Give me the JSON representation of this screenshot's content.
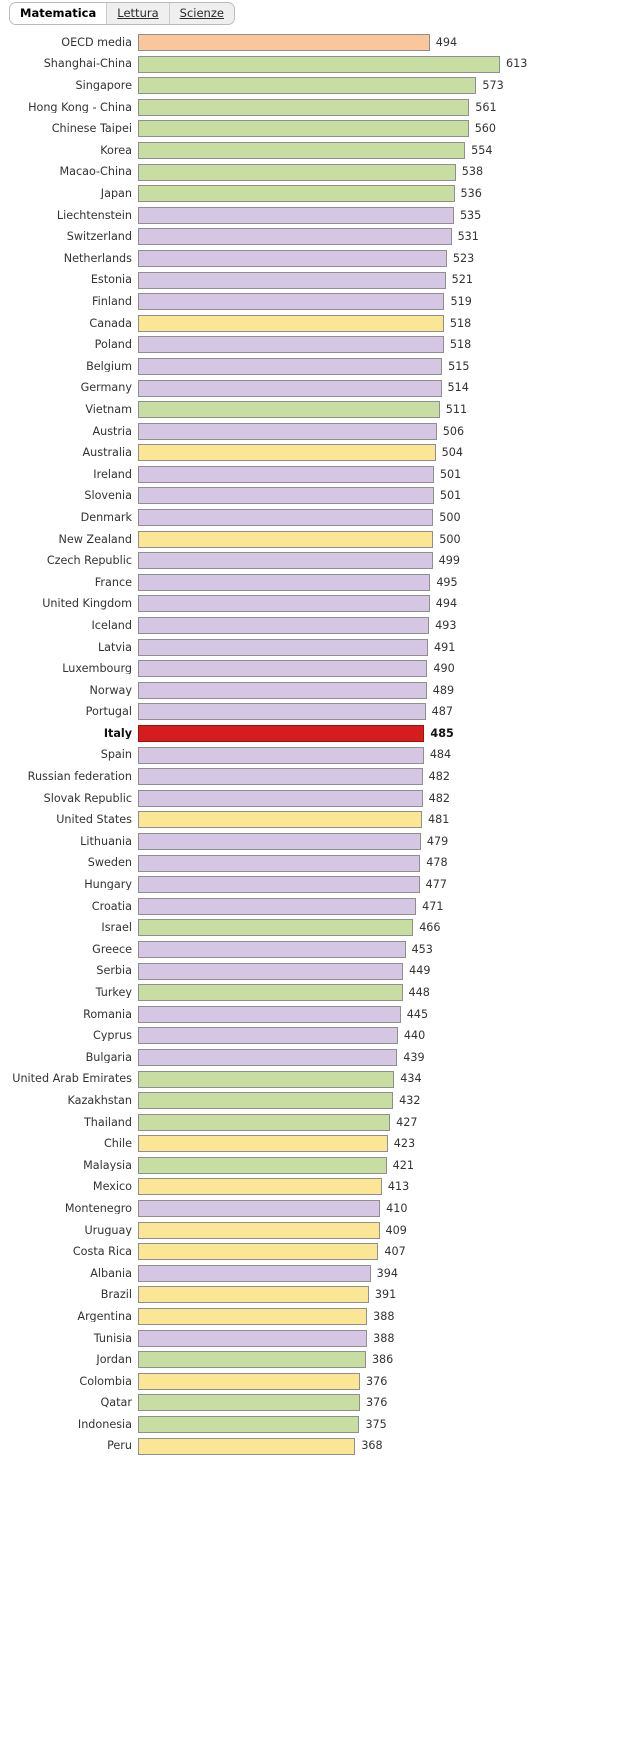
{
  "tabs": [
    {
      "label": "Matematica",
      "active": true
    },
    {
      "label": "Lettura",
      "active": false
    },
    {
      "label": "Scienze",
      "active": false
    }
  ],
  "palette": {
    "oecd": "#f9c79b",
    "asia": "#c7dda1",
    "europe": "#d5c6e3",
    "americas_oceania": "#fbe695",
    "italy": "#d51d1d",
    "bar_border": "#8f8f8f",
    "text": "#333333"
  },
  "chart_data": {
    "type": "bar",
    "title": "Matematica",
    "xlabel": "",
    "ylabel": "",
    "orientation": "horizontal",
    "xlim": [
      0,
      613
    ],
    "grid": false,
    "legend": null,
    "value_labels": true,
    "categories": [
      "OECD media",
      "Shanghai-China",
      "Singapore",
      "Hong Kong - China",
      "Chinese Taipei",
      "Korea",
      "Macao-China",
      "Japan",
      "Liechtenstein",
      "Switzerland",
      "Netherlands",
      "Estonia",
      "Finland",
      "Canada",
      "Poland",
      "Belgium",
      "Germany",
      "Vietnam",
      "Austria",
      "Australia",
      "Ireland",
      "Slovenia",
      "Denmark",
      "New Zealand",
      "Czech Republic",
      "France",
      "United Kingdom",
      "Iceland",
      "Latvia",
      "Luxembourg",
      "Norway",
      "Portugal",
      "Italy",
      "Spain",
      "Russian federation",
      "Slovak Republic",
      "United States",
      "Lithuania",
      "Sweden",
      "Hungary",
      "Croatia",
      "Israel",
      "Greece",
      "Serbia",
      "Turkey",
      "Romania",
      "Cyprus",
      "Bulgaria",
      "United Arab Emirates",
      "Kazakhstan",
      "Thailand",
      "Chile",
      "Malaysia",
      "Mexico",
      "Montenegro",
      "Uruguay",
      "Costa Rica",
      "Albania",
      "Brazil",
      "Argentina",
      "Tunisia",
      "Jordan",
      "Colombia",
      "Qatar",
      "Indonesia",
      "Peru"
    ],
    "values": [
      494,
      613,
      573,
      561,
      560,
      554,
      538,
      536,
      535,
      531,
      523,
      521,
      519,
      518,
      518,
      515,
      514,
      511,
      506,
      504,
      501,
      501,
      500,
      500,
      499,
      495,
      494,
      493,
      491,
      490,
      489,
      487,
      485,
      484,
      482,
      482,
      481,
      479,
      478,
      477,
      471,
      466,
      453,
      449,
      448,
      445,
      440,
      439,
      434,
      432,
      427,
      423,
      421,
      413,
      410,
      409,
      407,
      394,
      391,
      388,
      388,
      386,
      376,
      376,
      375,
      368
    ],
    "rows": [
      {
        "label": "OECD media",
        "value": 494,
        "group": "oecd",
        "highlight": false
      },
      {
        "label": "Shanghai-China",
        "value": 613,
        "group": "asia",
        "highlight": false
      },
      {
        "label": "Singapore",
        "value": 573,
        "group": "asia",
        "highlight": false
      },
      {
        "label": "Hong Kong - China",
        "value": 561,
        "group": "asia",
        "highlight": false
      },
      {
        "label": "Chinese Taipei",
        "value": 560,
        "group": "asia",
        "highlight": false
      },
      {
        "label": "Korea",
        "value": 554,
        "group": "asia",
        "highlight": false
      },
      {
        "label": "Macao-China",
        "value": 538,
        "group": "asia",
        "highlight": false
      },
      {
        "label": "Japan",
        "value": 536,
        "group": "asia",
        "highlight": false
      },
      {
        "label": "Liechtenstein",
        "value": 535,
        "group": "europe",
        "highlight": false
      },
      {
        "label": "Switzerland",
        "value": 531,
        "group": "europe",
        "highlight": false
      },
      {
        "label": "Netherlands",
        "value": 523,
        "group": "europe",
        "highlight": false
      },
      {
        "label": "Estonia",
        "value": 521,
        "group": "europe",
        "highlight": false
      },
      {
        "label": "Finland",
        "value": 519,
        "group": "europe",
        "highlight": false
      },
      {
        "label": "Canada",
        "value": 518,
        "group": "americas_oceania",
        "highlight": false
      },
      {
        "label": "Poland",
        "value": 518,
        "group": "europe",
        "highlight": false
      },
      {
        "label": "Belgium",
        "value": 515,
        "group": "europe",
        "highlight": false
      },
      {
        "label": "Germany",
        "value": 514,
        "group": "europe",
        "highlight": false
      },
      {
        "label": "Vietnam",
        "value": 511,
        "group": "asia",
        "highlight": false
      },
      {
        "label": "Austria",
        "value": 506,
        "group": "europe",
        "highlight": false
      },
      {
        "label": "Australia",
        "value": 504,
        "group": "americas_oceania",
        "highlight": false
      },
      {
        "label": "Ireland",
        "value": 501,
        "group": "europe",
        "highlight": false
      },
      {
        "label": "Slovenia",
        "value": 501,
        "group": "europe",
        "highlight": false
      },
      {
        "label": "Denmark",
        "value": 500,
        "group": "europe",
        "highlight": false
      },
      {
        "label": "New Zealand",
        "value": 500,
        "group": "americas_oceania",
        "highlight": false
      },
      {
        "label": "Czech Republic",
        "value": 499,
        "group": "europe",
        "highlight": false
      },
      {
        "label": "France",
        "value": 495,
        "group": "europe",
        "highlight": false
      },
      {
        "label": "United Kingdom",
        "value": 494,
        "group": "europe",
        "highlight": false
      },
      {
        "label": "Iceland",
        "value": 493,
        "group": "europe",
        "highlight": false
      },
      {
        "label": "Latvia",
        "value": 491,
        "group": "europe",
        "highlight": false
      },
      {
        "label": "Luxembourg",
        "value": 490,
        "group": "europe",
        "highlight": false
      },
      {
        "label": "Norway",
        "value": 489,
        "group": "europe",
        "highlight": false
      },
      {
        "label": "Portugal",
        "value": 487,
        "group": "europe",
        "highlight": false
      },
      {
        "label": "Italy",
        "value": 485,
        "group": "italy",
        "highlight": true
      },
      {
        "label": "Spain",
        "value": 484,
        "group": "europe",
        "highlight": false
      },
      {
        "label": "Russian federation",
        "value": 482,
        "group": "europe",
        "highlight": false
      },
      {
        "label": "Slovak Republic",
        "value": 482,
        "group": "europe",
        "highlight": false
      },
      {
        "label": "United States",
        "value": 481,
        "group": "americas_oceania",
        "highlight": false
      },
      {
        "label": "Lithuania",
        "value": 479,
        "group": "europe",
        "highlight": false
      },
      {
        "label": "Sweden",
        "value": 478,
        "group": "europe",
        "highlight": false
      },
      {
        "label": "Hungary",
        "value": 477,
        "group": "europe",
        "highlight": false
      },
      {
        "label": "Croatia",
        "value": 471,
        "group": "europe",
        "highlight": false
      },
      {
        "label": "Israel",
        "value": 466,
        "group": "asia",
        "highlight": false
      },
      {
        "label": "Greece",
        "value": 453,
        "group": "europe",
        "highlight": false
      },
      {
        "label": "Serbia",
        "value": 449,
        "group": "europe",
        "highlight": false
      },
      {
        "label": "Turkey",
        "value": 448,
        "group": "asia",
        "highlight": false
      },
      {
        "label": "Romania",
        "value": 445,
        "group": "europe",
        "highlight": false
      },
      {
        "label": "Cyprus",
        "value": 440,
        "group": "europe",
        "highlight": false
      },
      {
        "label": "Bulgaria",
        "value": 439,
        "group": "europe",
        "highlight": false
      },
      {
        "label": "United Arab Emirates",
        "value": 434,
        "group": "asia",
        "highlight": false
      },
      {
        "label": "Kazakhstan",
        "value": 432,
        "group": "asia",
        "highlight": false
      },
      {
        "label": "Thailand",
        "value": 427,
        "group": "asia",
        "highlight": false
      },
      {
        "label": "Chile",
        "value": 423,
        "group": "americas_oceania",
        "highlight": false
      },
      {
        "label": "Malaysia",
        "value": 421,
        "group": "asia",
        "highlight": false
      },
      {
        "label": "Mexico",
        "value": 413,
        "group": "americas_oceania",
        "highlight": false
      },
      {
        "label": "Montenegro",
        "value": 410,
        "group": "europe",
        "highlight": false
      },
      {
        "label": "Uruguay",
        "value": 409,
        "group": "americas_oceania",
        "highlight": false
      },
      {
        "label": "Costa Rica",
        "value": 407,
        "group": "americas_oceania",
        "highlight": false
      },
      {
        "label": "Albania",
        "value": 394,
        "group": "europe",
        "highlight": false
      },
      {
        "label": "Brazil",
        "value": 391,
        "group": "americas_oceania",
        "highlight": false
      },
      {
        "label": "Argentina",
        "value": 388,
        "group": "americas_oceania",
        "highlight": false
      },
      {
        "label": "Tunisia",
        "value": 388,
        "group": "europe",
        "highlight": false
      },
      {
        "label": "Jordan",
        "value": 386,
        "group": "asia",
        "highlight": false
      },
      {
        "label": "Colombia",
        "value": 376,
        "group": "americas_oceania",
        "highlight": false
      },
      {
        "label": "Qatar",
        "value": 376,
        "group": "asia",
        "highlight": false
      },
      {
        "label": "Indonesia",
        "value": 375,
        "group": "asia",
        "highlight": false
      },
      {
        "label": "Peru",
        "value": 368,
        "group": "americas_oceania",
        "highlight": false
      }
    ]
  }
}
